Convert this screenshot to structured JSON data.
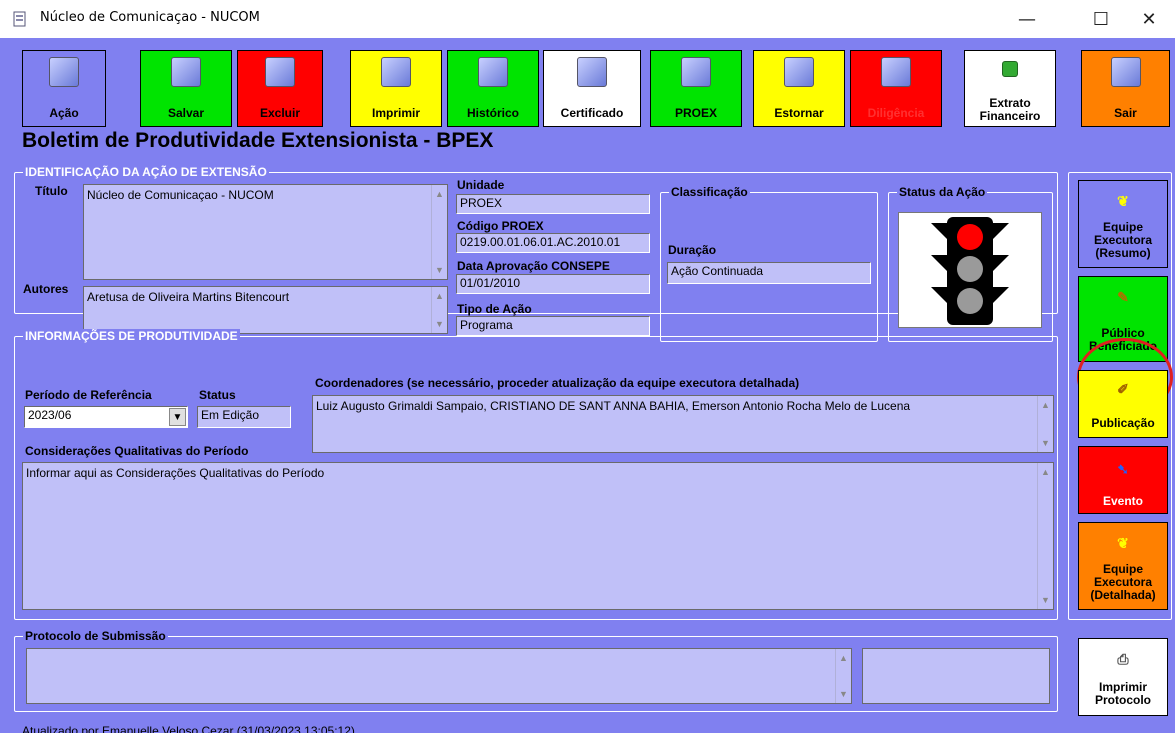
{
  "window": {
    "title": "Núcleo de Comunicaçao - NUCOM",
    "minimize": "—",
    "maximize": "☐",
    "close": "✕"
  },
  "toolbar": {
    "acao": "Ação",
    "salvar": "Salvar",
    "excluir": "Excluir",
    "imprimir": "Imprimir",
    "historico": "Histórico",
    "certificado": "Certificado",
    "proex": "PROEX",
    "estornar": "Estornar",
    "diligencia": "Diligência",
    "extrato1": "Extrato",
    "extrato2": "Financeiro",
    "sair": "Sair"
  },
  "heading": "Boletim de Produtividade Extensionista - BPEX",
  "identificacao": {
    "caption": "IDENTIFICAÇÃO DA AÇÃO DE EXTENSÃO",
    "titulo_label": "Título",
    "titulo_value": "Núcleo de Comunicaçao - NUCOM",
    "autores_label": "Autores",
    "autores_value": "Aretusa de Oliveira Martins Bitencourt",
    "unidade_label": "Unidade",
    "unidade_value": "PROEX",
    "codigo_label": "Código PROEX",
    "codigo_value": "0219.00.01.06.01.AC.2010.01",
    "data_label": "Data Aprovação CONSEPE",
    "data_value": "01/01/2010",
    "tipo_label": "Tipo de Ação",
    "tipo_value": "Programa",
    "classificacao_caption": "Classificação",
    "duracao_label": "Duração",
    "duracao_value": "Ação Continuada",
    "status_caption": "Status da Ação",
    "status_light": "red"
  },
  "produtividade": {
    "caption": "INFORMAÇÕES DE PRODUTIVIDADE",
    "periodo_label": "Período de Referência",
    "periodo_value": "2023/06",
    "status_label": "Status",
    "status_value": "Em Edição",
    "coord_label": "Coordenadores (se necessário, proceder atualização da equipe executora detalhada)",
    "coord_value": "Luiz Augusto Grimaldi Sampaio, CRISTIANO DE SANT ANNA BAHIA, Emerson Antonio Rocha Melo de Lucena",
    "consid_label": "Considerações Qualitativas do Período",
    "consid_value": "Informar aqui as Considerações Qualitativas do Período"
  },
  "protocolo": {
    "caption": "Protocolo de Submissão",
    "value": "",
    "side_value": ""
  },
  "sidebar": {
    "equipe_resumo": [
      "Equipe",
      "Executora",
      "(Resumo)"
    ],
    "publico": [
      "Público",
      "Beneficiado"
    ],
    "publicacao": "Publicação",
    "evento": "Evento",
    "equipe_detalhada": [
      "Equipe",
      "Executora",
      "(Detalhada)"
    ],
    "imprimir_protocolo": [
      "Imprimir",
      "Protocolo"
    ]
  },
  "status_line": "Atualizado por Emanuelle Veloso Cezar (31/03/2023 13:05:12)",
  "colors": {
    "background": "#8080f0",
    "green": "#00e400",
    "red": "#ff0000",
    "yellow": "#ffff00",
    "orange": "#ff8000",
    "field": "#c0c0f8"
  }
}
